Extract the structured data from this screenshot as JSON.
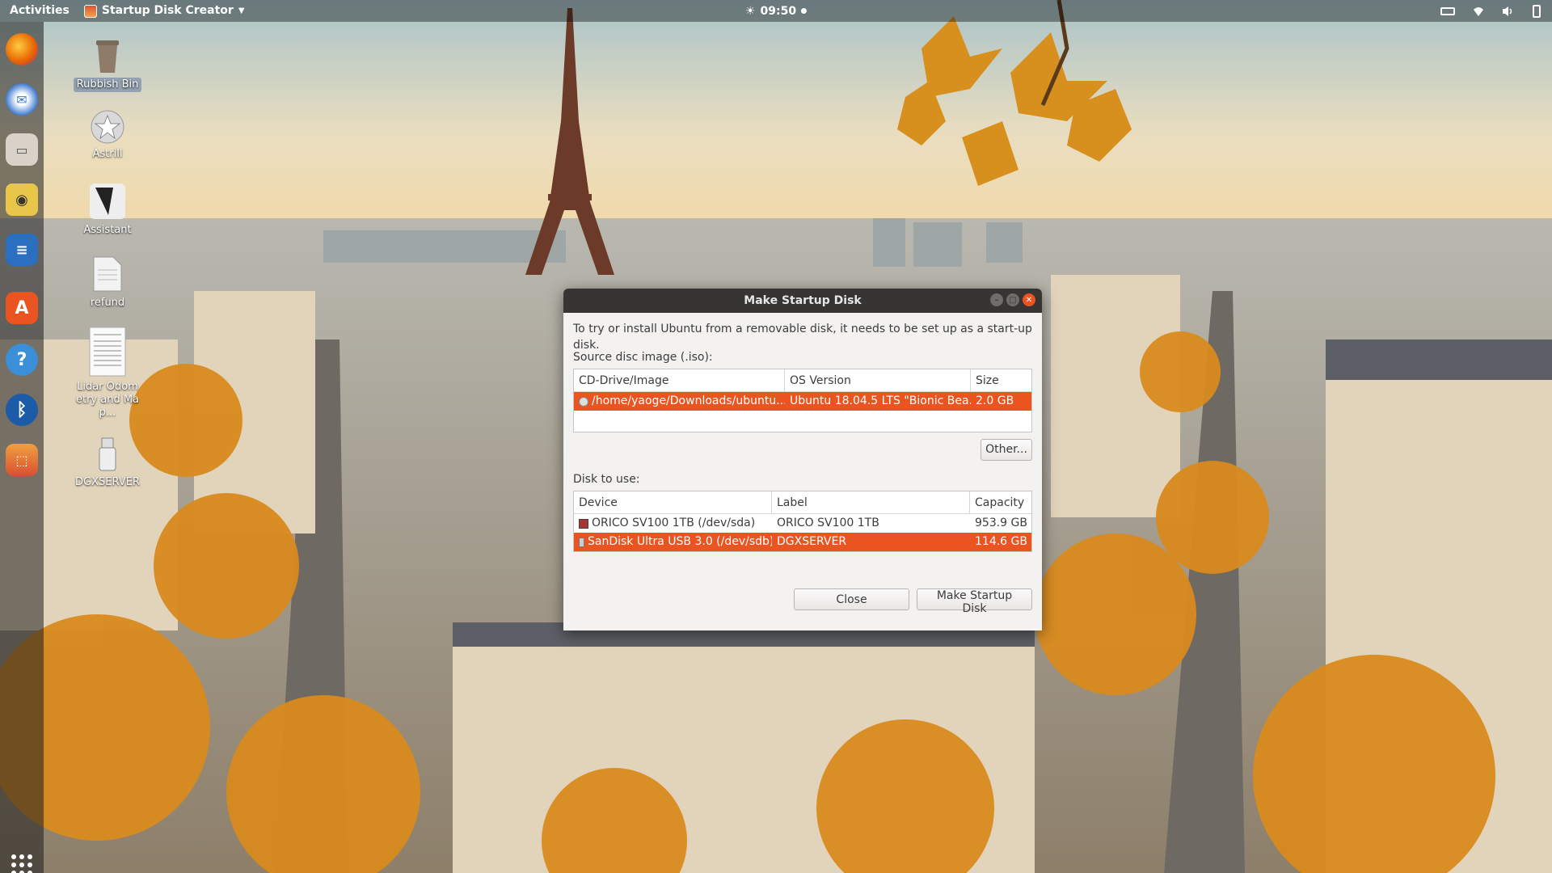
{
  "topbar": {
    "activities": "Activities",
    "app_name": "Startup Disk Creator",
    "clock": "09:50"
  },
  "dock": {
    "items": [
      {
        "name": "firefox",
        "color": "#e66000"
      },
      {
        "name": "thunderbird",
        "color": "#3f7bd0"
      },
      {
        "name": "files",
        "color": "#d8d2c8"
      },
      {
        "name": "rhythmbox",
        "color": "#e7c64a"
      },
      {
        "name": "libreoffice-writer",
        "color": "#2a6fc0"
      },
      {
        "name": "ubuntu-software",
        "color": "#e95420"
      },
      {
        "name": "help",
        "color": "#3a8fd8"
      },
      {
        "name": "bluetooth-app",
        "color": "#1c5ba8"
      },
      {
        "name": "startup-disk-creator",
        "color": "#f0a040"
      }
    ]
  },
  "desktop": {
    "icons": [
      {
        "label": "Rubbish Bin"
      },
      {
        "label": "Astrill"
      },
      {
        "label": "Assistant"
      },
      {
        "label": "refund"
      },
      {
        "label": "Lidar Odometry and Map..."
      },
      {
        "label": "DGXSERVER"
      }
    ]
  },
  "dialog": {
    "title": "Make Startup Disk",
    "intro": "To try or install Ubuntu from a removable disk, it needs to be set up as a start-up disk.",
    "source_label": "Source disc image (.iso):",
    "source_columns": [
      "CD-Drive/Image",
      "OS Version",
      "Size"
    ],
    "source_rows": [
      {
        "image": "/home/yaoge/Downloads/ubuntu...",
        "version": "Ubuntu 18.04.5 LTS \"Bionic Bea...",
        "size": "2.0 GB"
      }
    ],
    "other_button": "Other...",
    "disk_label": "Disk to use:",
    "disk_columns": [
      "Device",
      "Label",
      "Capacity"
    ],
    "disk_rows": [
      {
        "device": "ORICO SV100 1TB (/dev/sda)",
        "label": "ORICO SV100 1TB",
        "capacity": "953.9 GB"
      },
      {
        "device": "SanDisk Ultra USB 3.0 (/dev/sdb)",
        "label": "DGXSERVER",
        "capacity": "114.6 GB"
      }
    ],
    "close_button": "Close",
    "make_button": "Make Startup Disk"
  },
  "colors": {
    "accent": "#e95420",
    "titlebar": "#363534"
  }
}
